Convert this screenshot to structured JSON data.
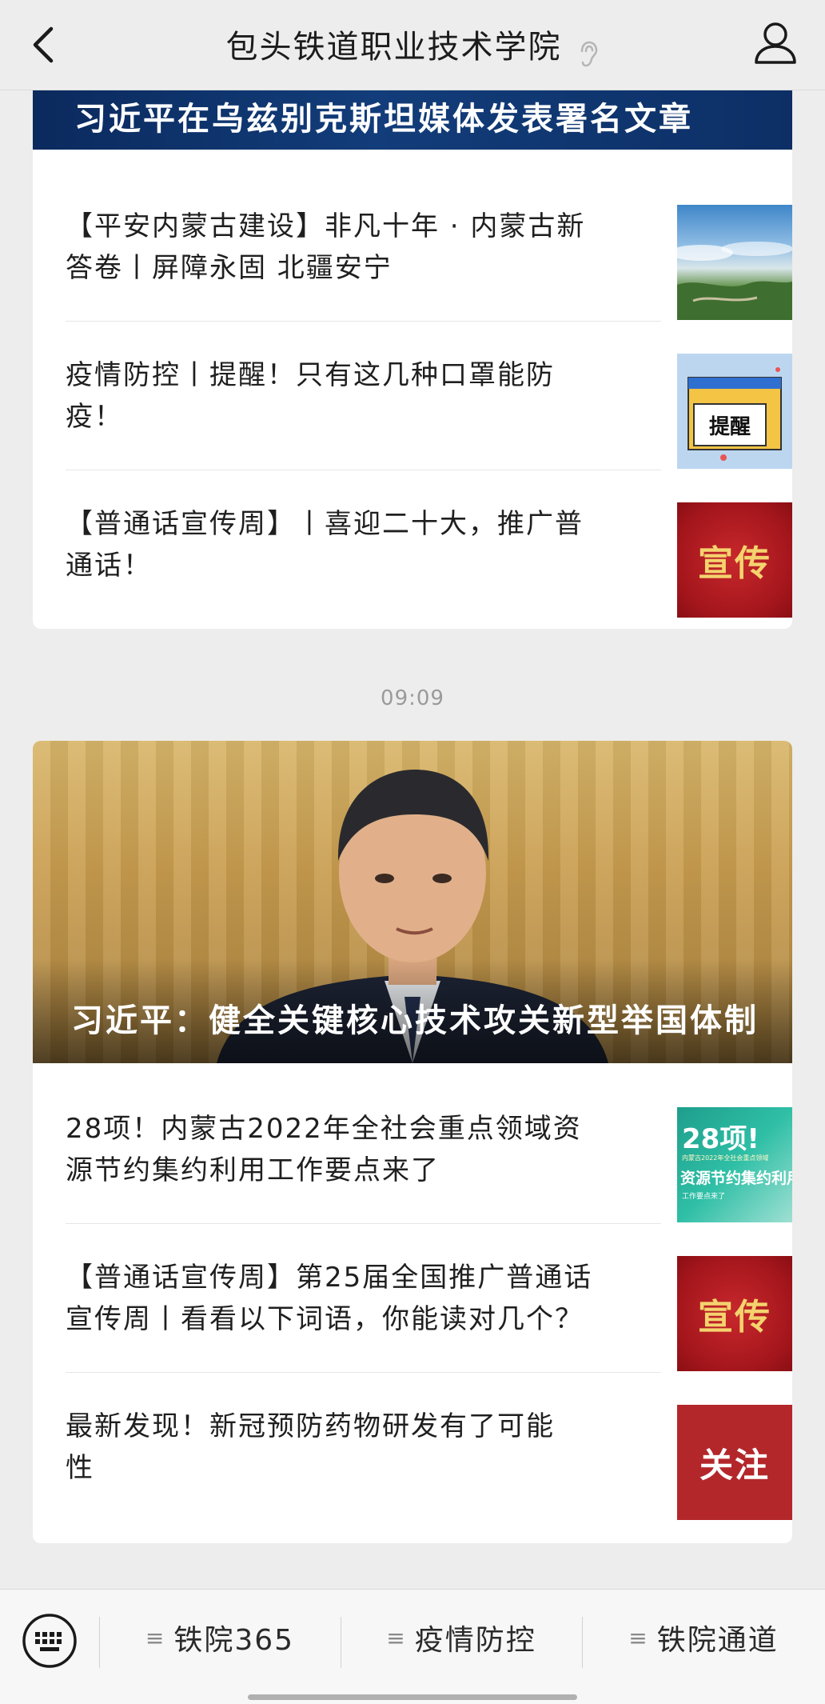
{
  "header": {
    "title": "包头铁道职业技术学院"
  },
  "group1": {
    "banner_title": "习近平在乌兹别克斯坦媒体发表署名文章",
    "items": [
      {
        "line1": "【平安内蒙古建设】非凡十年 · 内蒙古新",
        "line2": "答卷丨屏障永固 北疆安宁",
        "thumb": "landscape-photo"
      },
      {
        "line1": "疫情防控丨提醒！只有这几种口罩能防",
        "line2": "疫！",
        "thumb": "reminder-poster",
        "thumb_label": "提醒"
      },
      {
        "line1": "【普通话宣传周】丨喜迎二十大，推广普",
        "line2": "通话！",
        "thumb": "promotion-seal",
        "thumb_label": "宣传"
      }
    ]
  },
  "timestamp": "09:09",
  "group2": {
    "hero_title": "习近平：健全关键核心技术攻关新型举国体制",
    "items": [
      {
        "line1": "28项！内蒙古2022年全社会重点领域资",
        "line2": "源节约集约利用工作要点来了",
        "thumb": "resource-poster",
        "thumb_title": "28项!",
        "thumb_sub": "内蒙古2022年全社会重点领域",
        "thumb_main": "资源节约集约利用",
        "thumb_foot": "工作要点来了"
      },
      {
        "line1": "【普通话宣传周】第25届全国推广普通话",
        "line2": "宣传周丨看看以下词语，你能读对几个？",
        "thumb": "promotion-seal",
        "thumb_label": "宣传"
      },
      {
        "line1": "最新发现！新冠预防药物研发有了可能",
        "line2": "性",
        "thumb": "follow-badge",
        "thumb_label": "关注"
      }
    ]
  },
  "bottom_menu": {
    "items": [
      "铁院365",
      "疫情防控",
      "铁院通道"
    ]
  },
  "colors": {
    "background": "#ededed",
    "banner_blue": "#0b2a5e",
    "seal_red": "#a4161c",
    "seal_gold": "#f4d36e"
  }
}
